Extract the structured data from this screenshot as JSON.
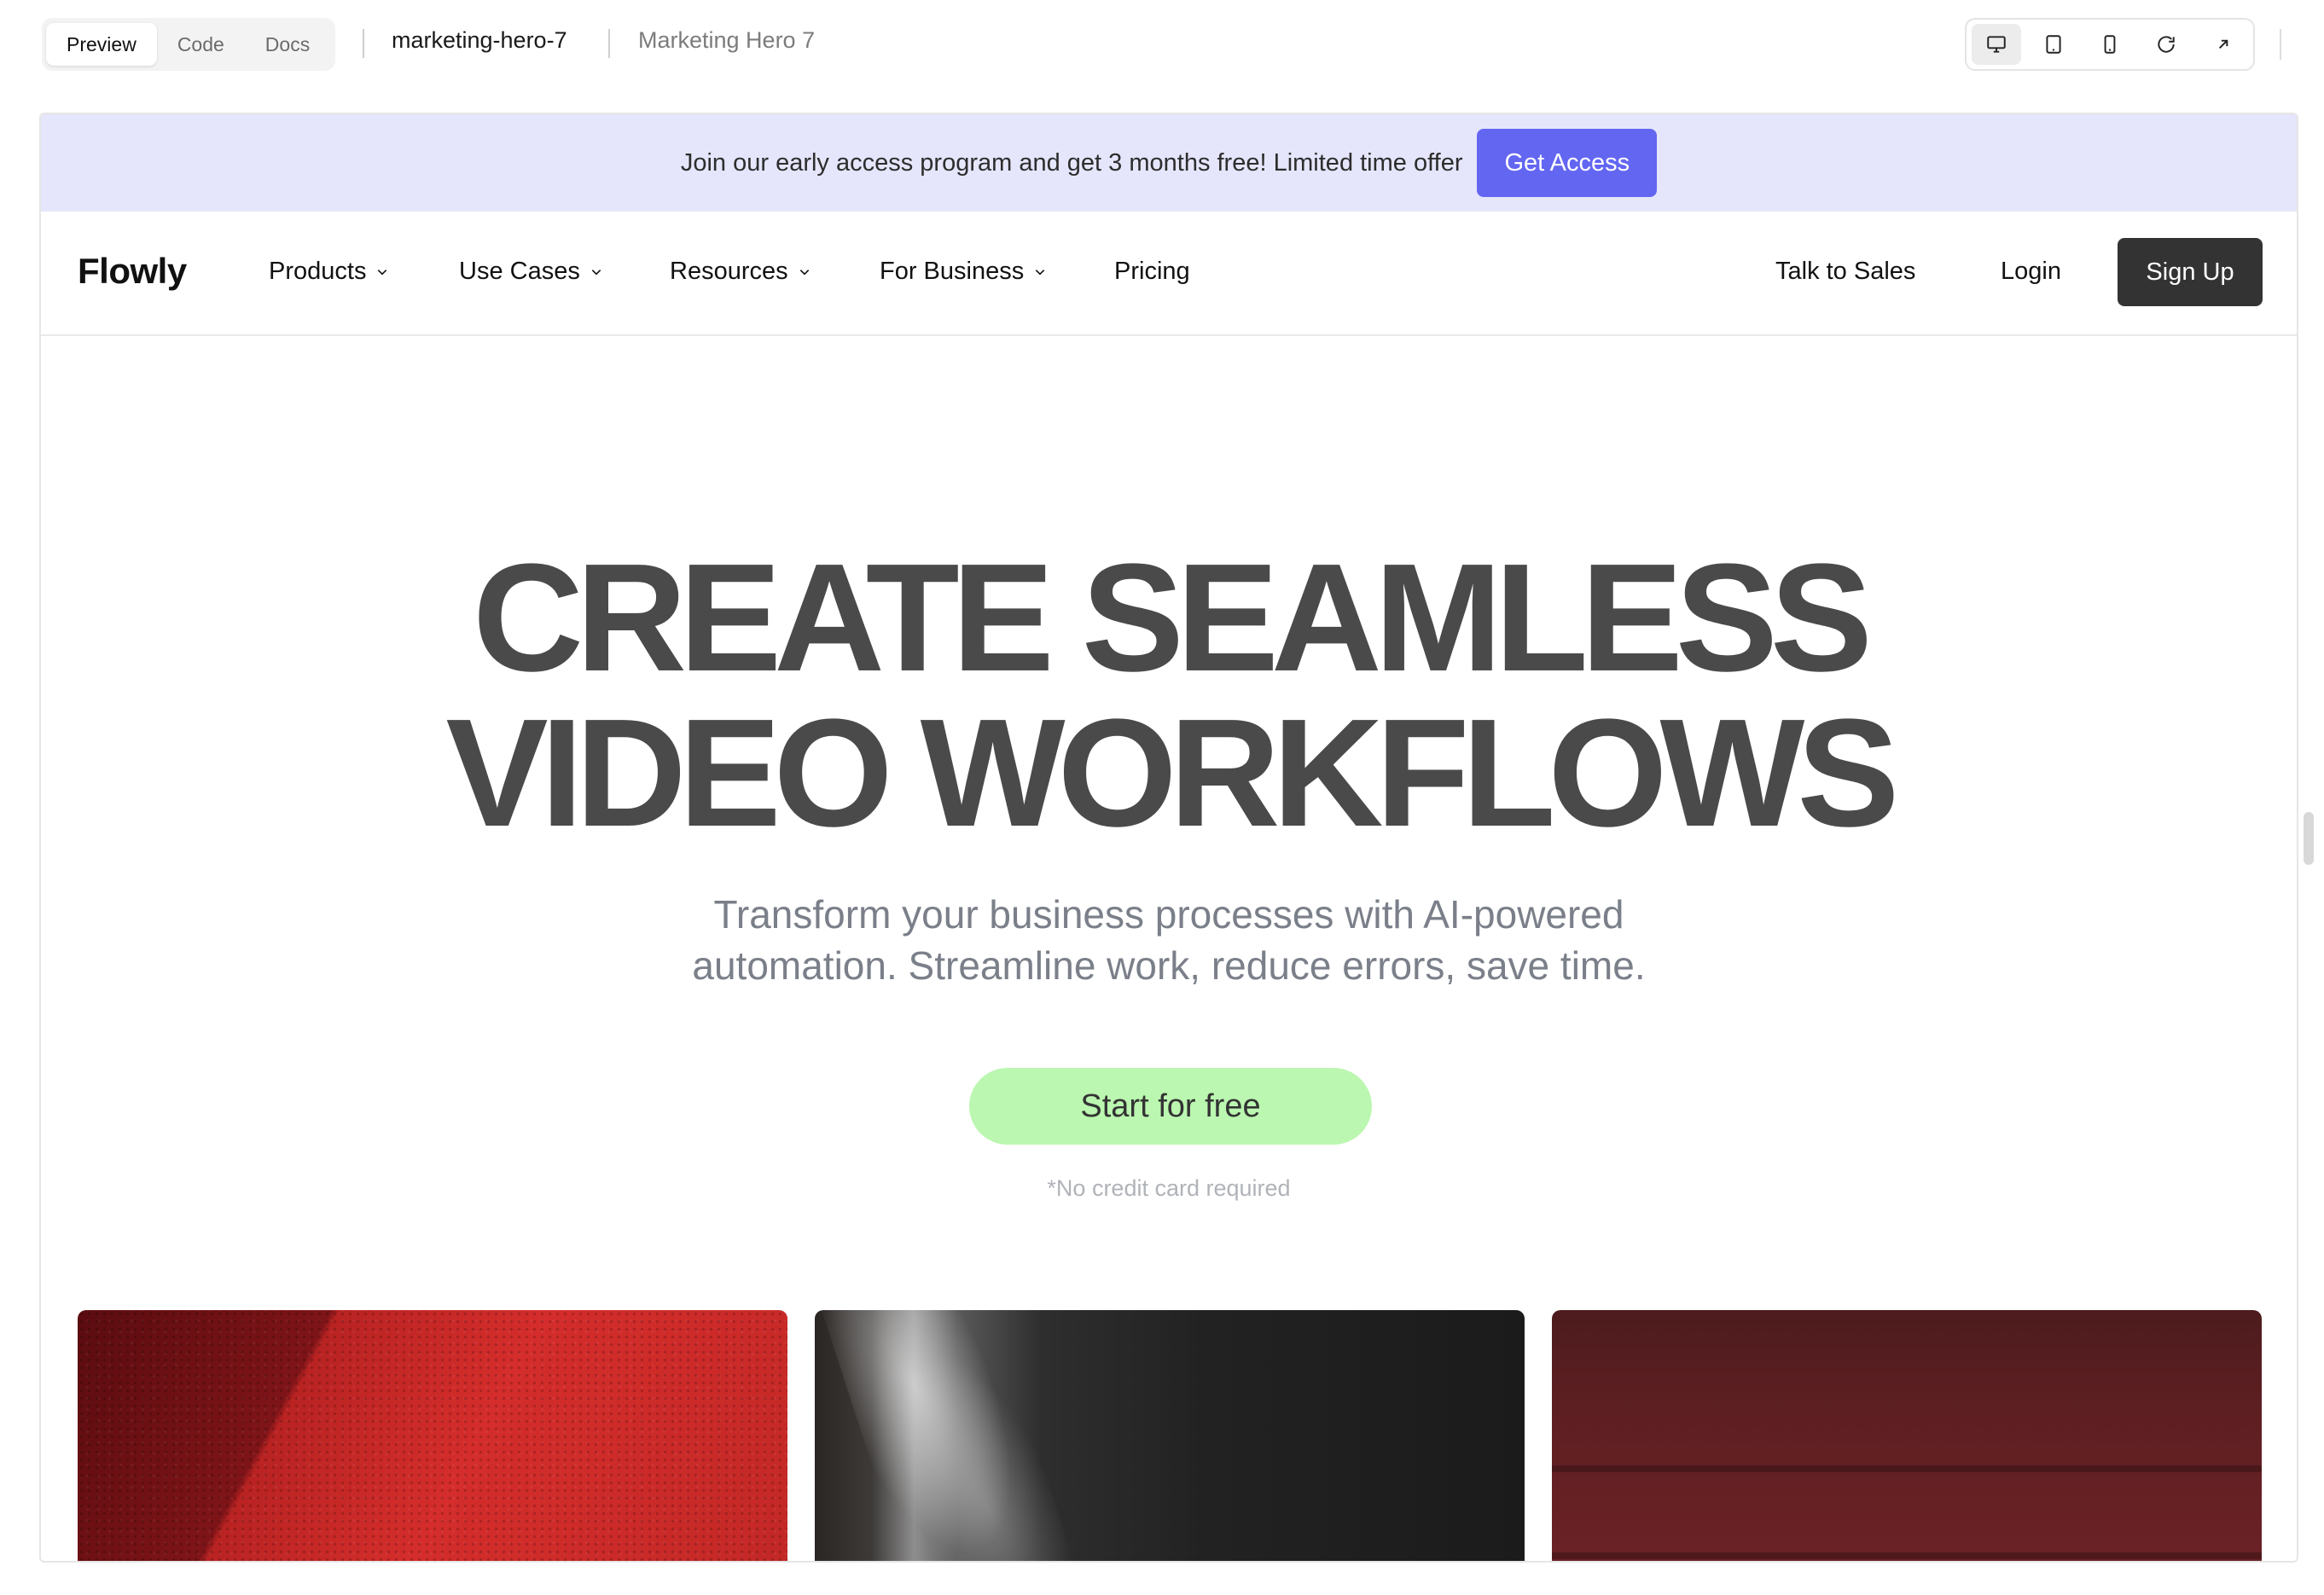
{
  "viewer": {
    "tabs": [
      {
        "label": "Preview",
        "active": true
      },
      {
        "label": "Code",
        "active": false
      },
      {
        "label": "Docs",
        "active": false
      }
    ],
    "component_id": "marketing-hero-7",
    "component_name": "Marketing Hero 7",
    "device_buttons": [
      "desktop-icon",
      "tablet-icon",
      "mobile-icon",
      "refresh-icon",
      "open-external-icon"
    ]
  },
  "announcement": {
    "text": "Join our early access program and get 3 months free! Limited time offer",
    "button": "Get Access",
    "bg_color": "#e5e6fb",
    "button_color": "#6366f1"
  },
  "nav": {
    "logo": "Flowly",
    "items": [
      {
        "label": "Products",
        "has_dropdown": true
      },
      {
        "label": "Use Cases",
        "has_dropdown": true
      },
      {
        "label": "Resources",
        "has_dropdown": true
      },
      {
        "label": "For Business",
        "has_dropdown": true
      },
      {
        "label": "Pricing",
        "has_dropdown": false
      }
    ],
    "talk_to_sales": "Talk to Sales",
    "login": "Login",
    "signup": "Sign Up"
  },
  "hero": {
    "title_line1": "CREATE SEAMLESS",
    "title_line2": "VIDEO WORKFLOWS",
    "subtitle_line1": "Transform your business processes with AI-powered",
    "subtitle_line2": "automation. Streamline work, reduce errors, save time.",
    "cta": "Start for free",
    "cta_color": "#bbf7b0",
    "note": "*No credit card required"
  }
}
